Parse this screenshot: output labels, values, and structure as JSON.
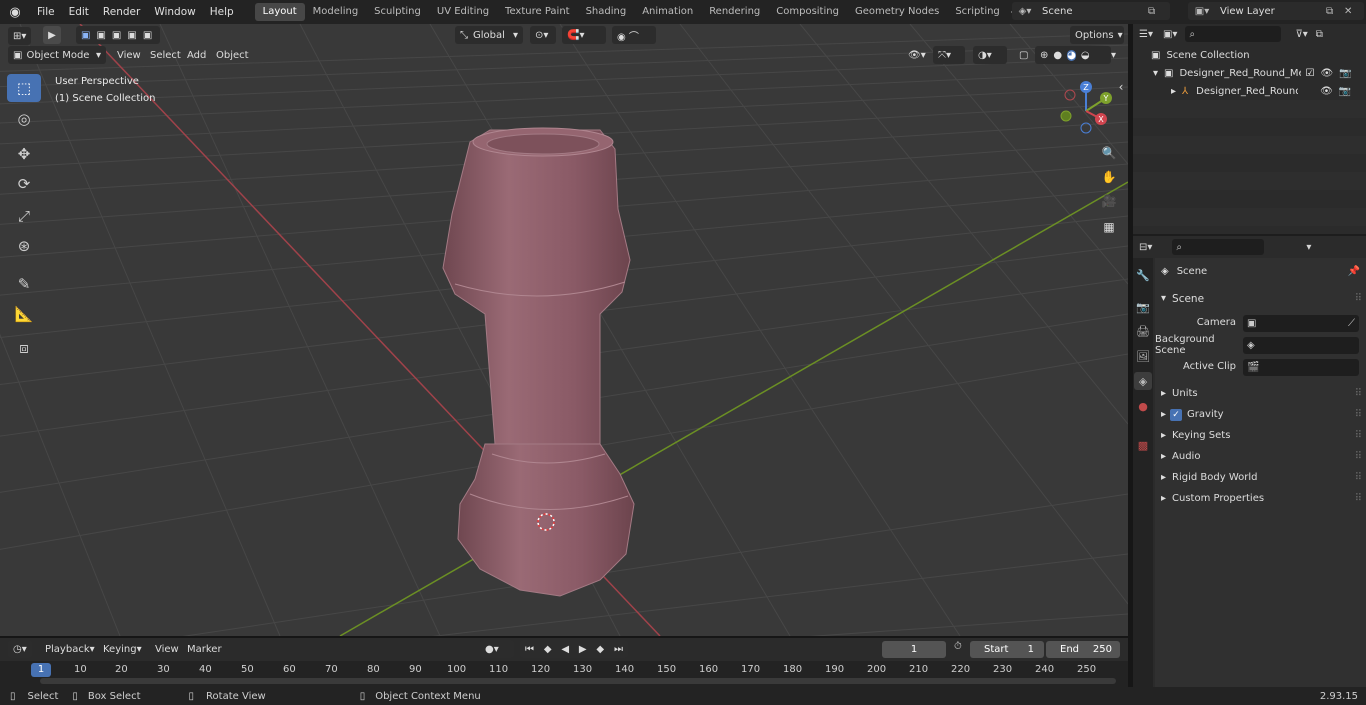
{
  "menubar": {
    "items": [
      "File",
      "Edit",
      "Render",
      "Window",
      "Help"
    ],
    "workspaces": [
      "Layout",
      "Modeling",
      "Sculpting",
      "UV Editing",
      "Texture Paint",
      "Shading",
      "Animation",
      "Rendering",
      "Compositing",
      "Geometry Nodes",
      "Scripting"
    ],
    "active_workspace": "Layout",
    "scene": "Scene",
    "view_layer": "View Layer"
  },
  "viewport": {
    "mode": "Object Mode",
    "menus": [
      "View",
      "Select",
      "Add",
      "Object"
    ],
    "transform_orientation": "Global",
    "options_label": "Options",
    "perspective_label": "User Perspective",
    "collection_label": "(1) Scene Collection",
    "gizmo": {
      "x": "X",
      "y": "Y",
      "z": "Z"
    }
  },
  "outliner": {
    "root": "Scene Collection",
    "collection": "Designer_Red_Round_Metal_(",
    "object": "Designer_Red_Round_Me"
  },
  "properties": {
    "context": "Scene",
    "panel": "Scene",
    "camera_label": "Camera",
    "background_label": "Background Scene",
    "clip_label": "Active Clip",
    "subpanels": [
      "Units",
      "Gravity",
      "Keying Sets",
      "Audio",
      "Rigid Body World",
      "Custom Properties"
    ]
  },
  "timeline": {
    "menus": [
      "Playback",
      "Keying",
      "View",
      "Marker"
    ],
    "current_frame": "1",
    "start_label": "Start",
    "start": "1",
    "end_label": "End",
    "end": "250",
    "ruler": [
      "10",
      "20",
      "30",
      "40",
      "50",
      "60",
      "70",
      "80",
      "90",
      "100",
      "110",
      "120",
      "130",
      "140",
      "150",
      "160",
      "170",
      "180",
      "190",
      "200",
      "210",
      "220",
      "230",
      "240",
      "250"
    ]
  },
  "statusbar": {
    "select": "Select",
    "box_select": "Box Select",
    "rotate": "Rotate View",
    "context_menu": "Object Context Menu",
    "version": "2.93.15"
  },
  "colors": {
    "accent": "#4772b3",
    "viewport": "#393939",
    "object": "#8a5a66"
  }
}
